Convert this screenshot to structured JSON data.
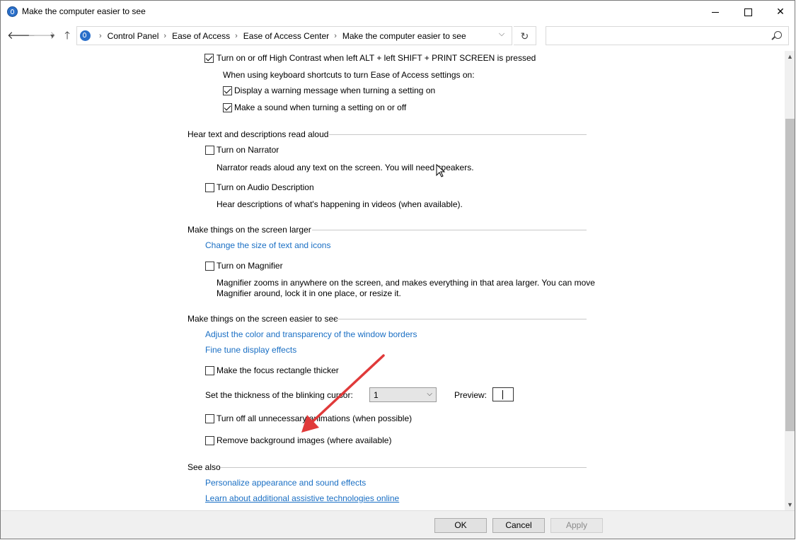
{
  "window": {
    "title": "Make the computer easier to see"
  },
  "breadcrumbs": [
    "Control Panel",
    "Ease of Access",
    "Ease of Access Center",
    "Make the computer easier to see"
  ],
  "search": {
    "placeholder": ""
  },
  "top_options": {
    "high_contrast_shortcut": {
      "label": "Turn on or off High Contrast when left ALT + left SHIFT + PRINT SCREEN is pressed",
      "checked": true
    },
    "shortcut_note": "When using keyboard shortcuts to turn Ease of Access settings on:",
    "display_warning": {
      "label": "Display a warning message when turning a setting on",
      "checked": true
    },
    "make_sound": {
      "label": "Make a sound when turning a setting on or off",
      "checked": true
    }
  },
  "hear_section": {
    "heading": "Hear text and descriptions read aloud",
    "narrator": {
      "label": "Turn on Narrator",
      "checked": false,
      "description": "Narrator reads aloud any text on the screen. You will need speakers."
    },
    "audio_description": {
      "label": "Turn on Audio Description",
      "checked": false,
      "description": "Hear descriptions of what's happening in videos (when available)."
    }
  },
  "larger_section": {
    "heading": "Make things on the screen larger",
    "link_text_size": "Change the size of text and icons",
    "magnifier": {
      "label": "Turn on Magnifier",
      "checked": false,
      "description_line1": "Magnifier zooms in anywhere on the screen, and makes everything in that area larger. You can move",
      "description_line2": "Magnifier around, lock it in one place, or resize it."
    }
  },
  "easier_section": {
    "heading": "Make things on the screen easier to see",
    "link_window_borders": "Adjust the color and transparency of the window borders",
    "link_display_effects": "Fine tune display effects",
    "focus_rect": {
      "label": "Make the focus rectangle thicker",
      "checked": false
    },
    "cursor_thickness_label": "Set the thickness of the blinking cursor:",
    "cursor_thickness_value": "1",
    "preview_label": "Preview:",
    "animations": {
      "label": "Turn off all unnecessary animations (when possible)",
      "checked": false
    },
    "background_images": {
      "label": "Remove background images (where available)",
      "checked": false
    }
  },
  "see_also": {
    "heading": "See also",
    "link_personalize": "Personalize appearance and sound effects",
    "link_assistive": "Learn about additional assistive technologies online"
  },
  "footer": {
    "ok": "OK",
    "cancel": "Cancel",
    "apply": "Apply"
  },
  "annotation": {
    "arrow_color": "#e03a3a"
  },
  "colors": {
    "link": "#1a6fc4",
    "section_line": "#c8c8c8"
  }
}
